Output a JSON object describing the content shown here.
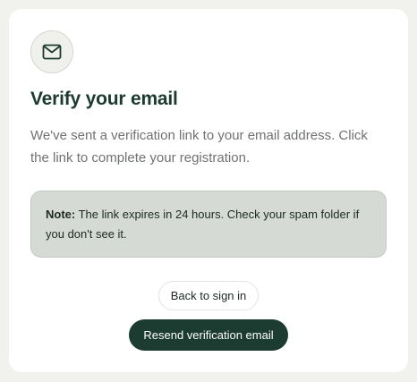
{
  "card": {
    "icon": "mail-icon",
    "title": "Verify your email",
    "description": "We've sent a verification link to your email address. Click the link to complete your registration."
  },
  "note": {
    "label": "Note:",
    "text": " The link expires in 24 hours. Check your spam folder if you don't see it."
  },
  "actions": {
    "back_label": "Back to sign in",
    "resend_label": "Resend verification email"
  },
  "colors": {
    "accent": "#1c3b31",
    "note_bg": "#d5dbd4",
    "page_bg": "#f1f2ee"
  }
}
